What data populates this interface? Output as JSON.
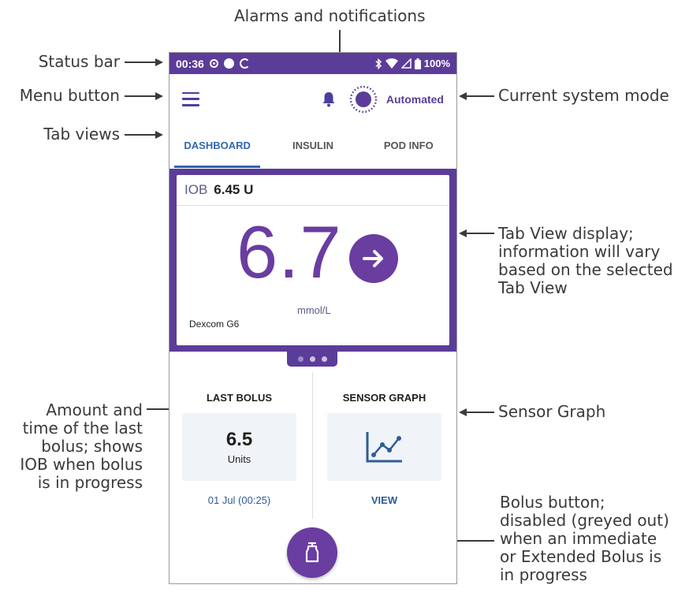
{
  "callouts": {
    "alarms": "Alarms and notifications",
    "status_bar": "Status bar",
    "menu_button": "Menu button",
    "tab_views": "Tab views",
    "system_mode": "Current system mode",
    "tab_view_display": [
      "Tab View display;",
      "information will vary",
      "based on the selected",
      "Tab View"
    ],
    "sensor_graph": "Sensor Graph",
    "last_bolus": [
      "Amount and",
      "time of the last",
      "bolus; shows",
      "IOB when bolus",
      "is in progress"
    ],
    "bolus_button": [
      "Bolus button;",
      "disabled (greyed out)",
      "when an immediate",
      "or Extended Bolus is",
      "in progress"
    ]
  },
  "status_bar": {
    "time": "00:36",
    "battery": "100%",
    "icons": [
      "pod-status-icon",
      "solid-dot-icon",
      "sync-icon",
      "bluetooth-icon",
      "wifi-icon",
      "signal-icon",
      "battery-icon"
    ]
  },
  "app_bar": {
    "mode": "Automated"
  },
  "tabs": [
    "DASHBOARD",
    "INSULIN",
    "POD INFO"
  ],
  "active_tab": 0,
  "dashboard": {
    "iob_label": "IOB",
    "iob_value": "6.45 U",
    "glucose": "6.7",
    "unit": "mmol/L",
    "sensor": "Dexcom G6",
    "trend": "steady-arrow-icon",
    "page_count": 3,
    "active_page": 0
  },
  "last_bolus": {
    "title": "LAST BOLUS",
    "amount": "6.5",
    "unit": "Units",
    "time": "01 Jul (00:25)"
  },
  "sensor_graph": {
    "title": "SENSOR GRAPH",
    "link": "VIEW",
    "icon": "line-graph-icon"
  },
  "bolus_button": {
    "icon": "bolus-icon"
  },
  "colors": {
    "brand_purple": "#5b3d99",
    "glucose_purple": "#6a3da1",
    "tab_blue": "#2f67b0",
    "link_blue": "#2f5c95"
  }
}
